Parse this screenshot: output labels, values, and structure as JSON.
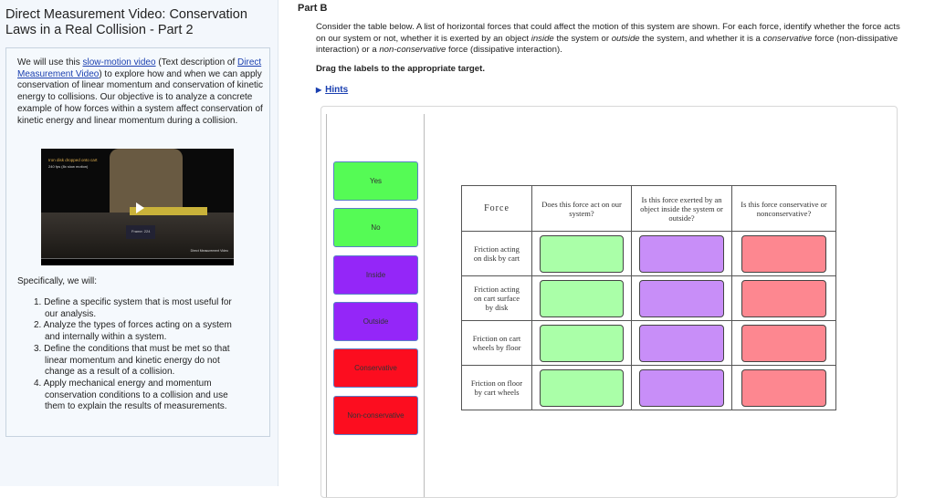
{
  "sidebar": {
    "title": "Direct Measurement Video: Conservation Laws in a Real Collision - Part 2",
    "intro_1": "We will use this ",
    "link_video": "slow-motion video",
    "intro_2": " (Text description of ",
    "link_dmv": "Direct Measurement Video",
    "intro_3": ") to explore how and when we can apply conservation of linear momentum and conservation of kinetic energy to collisions. Our objective is to analyze a concrete example of how forces within a system affect conservation of kinetic energy and linear momentum during a collision.",
    "video": {
      "caption_title": "Iron disk dropped onto cart",
      "caption_sub": "240 fps (8x slow motion)",
      "frame_label": "Frame: 224",
      "credit": "Direct Measurement Video"
    },
    "specifically": "Specifically, we will:",
    "objectives": [
      "1. Define a specific system that is most useful for our analysis.",
      "2. Analyze the types of forces acting on a system and internally within a system.",
      "3. Define the conditions that must be met so that linear momentum and kinetic energy do not change as a result of a collision.",
      "4. Apply mechanical energy and momentum conservation conditions to a collision and use them to explain the results of measurements."
    ]
  },
  "main": {
    "part": "Part B",
    "desc_1": "Consider the table below. A list of horizontal forces that could affect the motion of this system are shown. For each force, identify whether the force acts on our system or not, whether it is exerted by an object ",
    "desc_inside": "inside",
    "desc_2": " the system or ",
    "desc_outside": "outside",
    "desc_3": " the system, and whether it is a ",
    "desc_cons": "conservative",
    "desc_4": " force (non-dissipative interaction) or a ",
    "desc_noncons": "non-conservative",
    "desc_5": " force (dissipative interaction).",
    "instruction": "Drag the labels to the appropriate target.",
    "hints": "Hints",
    "labels": [
      {
        "text": "Yes",
        "color": "#55fb55"
      },
      {
        "text": "No",
        "color": "#55fb55"
      },
      {
        "text": "Inside",
        "color": "#9426f8"
      },
      {
        "text": "Outside",
        "color": "#9426f8"
      },
      {
        "text": "Conservative",
        "color": "#fc0d1f"
      },
      {
        "text": "Non-conservative",
        "color": "#fc0d1f"
      }
    ],
    "table": {
      "headers": [
        "Force",
        "Does this force act on our system?",
        "Is this force exerted by an object inside the system or outside?",
        "Is this force conservative or nonconservative?"
      ],
      "rows": [
        "Friction acting on disk by cart",
        "Friction acting on cart surface by disk",
        "Friction on cart wheels by floor",
        "Friction on floor by cart wheels"
      ],
      "slot_colors": [
        "#aaffa8",
        "#c88ef8",
        "#fd8790"
      ]
    }
  }
}
